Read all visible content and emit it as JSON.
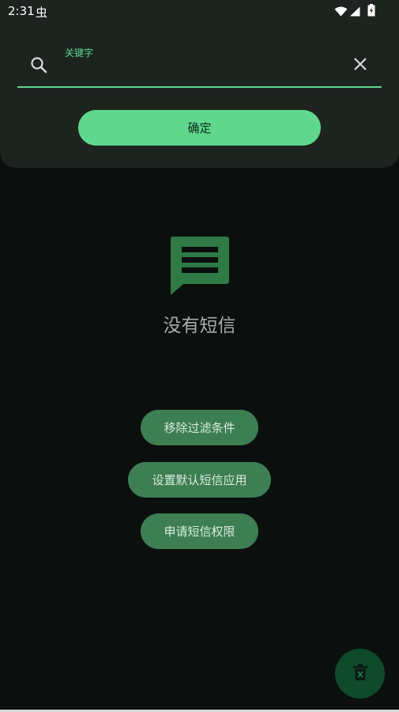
{
  "status_bar": {
    "time": "2:31",
    "notification_glyph": "虫",
    "icons": [
      "wifi-icon",
      "signal-icon",
      "battery-icon"
    ]
  },
  "search": {
    "label": "关键字",
    "value": "",
    "placeholder": "",
    "icon": "search-icon",
    "clear_icon": "close-icon"
  },
  "confirm_label": "确定",
  "empty_state": {
    "icon": "message-icon",
    "text": "没有短信"
  },
  "actions": {
    "remove_filter": "移除过滤条件",
    "set_default": "设置默认短信应用",
    "request_permission": "申请短信权限"
  },
  "fab": {
    "icon": "delete-icon"
  },
  "colors": {
    "accent": "#5fd88d",
    "background": "#0b0f0d",
    "panel": "#1d2420",
    "button": "#3d7e52",
    "fab": "#0f4a2a"
  }
}
